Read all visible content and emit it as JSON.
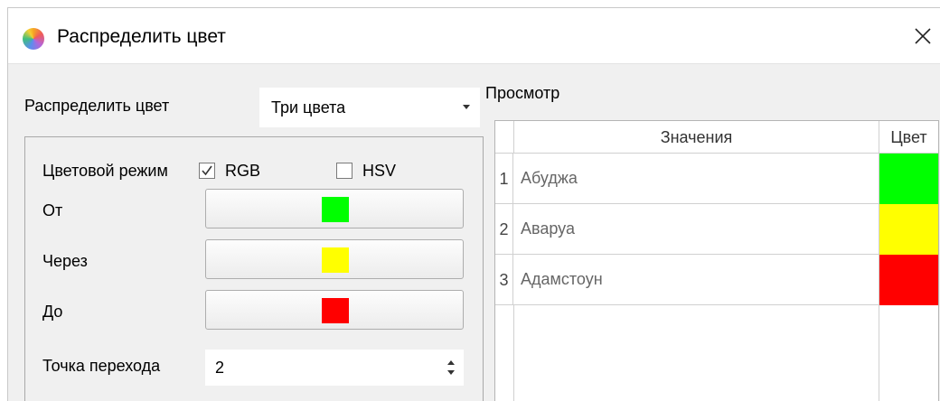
{
  "window": {
    "title": "Распределить цвет"
  },
  "form": {
    "distribute_label": "Распределить цвет",
    "distribute_value": "Три цвета",
    "color_mode_label": "Цветовой режим",
    "rgb_label": "RGB",
    "rgb_checked": true,
    "hsv_label": "HSV",
    "hsv_checked": false,
    "from_label": "От",
    "from_color": "#00ff00",
    "via_label": "Через",
    "via_color": "#ffff00",
    "to_label": "До",
    "to_color": "#ff0000",
    "transition_label": "Точка перехода",
    "transition_value": "2"
  },
  "preview": {
    "title": "Просмотр",
    "columns": [
      "Значения",
      "Цвет"
    ],
    "rows": [
      {
        "index": "1",
        "value": "Абуджа",
        "color": "#00ff00"
      },
      {
        "index": "2",
        "value": "Аваруа",
        "color": "#ffff00"
      },
      {
        "index": "3",
        "value": "Адамстоун",
        "color": "#ff0000"
      }
    ]
  }
}
